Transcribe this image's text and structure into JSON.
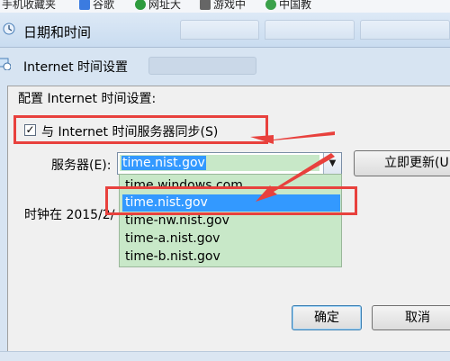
{
  "bookmark_bar": {
    "items": [
      {
        "label": "手机收藏夹",
        "icon": "folder-icon",
        "color": "#d8b24a"
      },
      {
        "label": "谷歌",
        "icon": "google-icon",
        "color": "#3b7be0"
      },
      {
        "label": "网址大",
        "icon": "web-icon",
        "color": "#2e9b3e"
      },
      {
        "label": "游戏中",
        "icon": "gamepad-icon",
        "color": "#666666"
      },
      {
        "label": "中国教",
        "icon": "education-icon",
        "color": "#3aa04a"
      }
    ]
  },
  "outer_window": {
    "title": "日期和时间"
  },
  "dialog": {
    "title": "Internet 时间设置",
    "heading": "配置 Internet 时间设置:",
    "sync_label": "与 Internet 时间服务器同步(S)",
    "sync_checked": true,
    "server_label": "服务器(E):",
    "server_value": "time.nist.gov",
    "update_button": "立即更新(U",
    "clock_text": "时钟在 2015/2/",
    "ok_button": "确定",
    "cancel_button": "取消",
    "server_options": [
      "time.windows.com",
      "time.nist.gov",
      "time-nw.nist.gov",
      "time-a.nist.gov",
      "time-b.nist.gov"
    ],
    "selected_option_index": 1
  },
  "annotations": {
    "highlight_color": "#e8413d"
  },
  "colors": {
    "selection_blue": "#3399ff",
    "dropdown_green": "#c8e8c8"
  }
}
